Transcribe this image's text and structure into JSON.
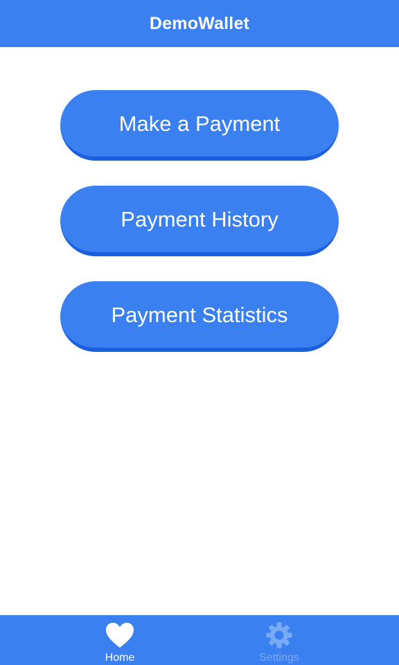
{
  "header": {
    "title": "DemoWallet"
  },
  "menu": {
    "items": [
      {
        "label": "Make a Payment"
      },
      {
        "label": "Payment History"
      },
      {
        "label": "Payment Statistics"
      }
    ]
  },
  "tabbar": {
    "tabs": [
      {
        "label": "Home",
        "icon": "heart-icon",
        "active": true
      },
      {
        "label": "Settings",
        "icon": "gear-icon",
        "active": false
      }
    ]
  },
  "colors": {
    "primary": "#3a80f0",
    "button_shadow": "#1a60de",
    "inactive_tab": "#79aaf6",
    "background": "#ffffff"
  }
}
